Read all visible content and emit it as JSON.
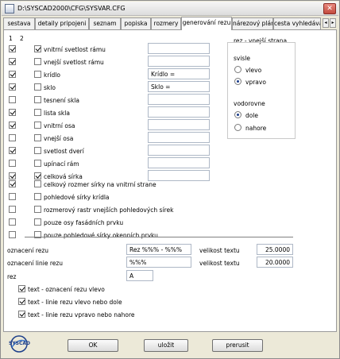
{
  "window": {
    "title": "D:\\SYSCAD2000\\CFG\\SYSVAR.CFG"
  },
  "tabs": [
    "sestava",
    "detaily pripojeni",
    "seznam",
    "popiska",
    "rozmery",
    "generování rezu",
    "nárezový plán",
    "cesta vyhledávání"
  ],
  "active_tab": "generování rezu",
  "columns": [
    "1",
    "2"
  ],
  "rows": [
    {
      "label": "vnitrní svetlost rámu",
      "c1": true,
      "c2": true,
      "value": ""
    },
    {
      "label": "vnejší svetlost rámu",
      "c1": true,
      "c2": false,
      "value": ""
    },
    {
      "label": "krídlo",
      "c1": true,
      "c2": false,
      "value": "Krídlo ="
    },
    {
      "label": "sklo",
      "c1": true,
      "c2": false,
      "value": "Sklo  ="
    },
    {
      "label": "tesnení skla",
      "c1": false,
      "c2": false,
      "value": ""
    },
    {
      "label": "lista skla",
      "c1": true,
      "c2": false,
      "value": ""
    },
    {
      "label": "vnitrní osa",
      "c1": true,
      "c2": false,
      "value": ""
    },
    {
      "label": "vnejší osa",
      "c1": false,
      "c2": false,
      "value": ""
    },
    {
      "label": "svetlost dverí",
      "c1": true,
      "c2": false,
      "value": ""
    },
    {
      "label": "upínací rám",
      "c1": false,
      "c2": false,
      "value": ""
    },
    {
      "label": "celková sírka",
      "c1": true,
      "c2": true,
      "value": ""
    }
  ],
  "extra_rows": [
    {
      "label": "celkový rozmer sírky na vnitrní strane",
      "c1": true,
      "c2": false
    },
    {
      "label": "pohledové sírky krídla",
      "c1": false,
      "c2": false
    },
    {
      "label": "rozmerový rastr vnejších pohledových sírek",
      "c1": false,
      "c2": false
    },
    {
      "label": "pouze osy fasádních prvku",
      "c1": false,
      "c2": false
    },
    {
      "label": "pouze pohledové sírky okenních prvku",
      "c1": false,
      "c2": false
    }
  ],
  "side_group": {
    "title": "rez - vnejší strana",
    "vertical_label": "svisle",
    "vertical_options": [
      {
        "label": "vlevo",
        "checked": false
      },
      {
        "label": "vpravo",
        "checked": true
      }
    ],
    "horizontal_label": "vodorovne",
    "horizontal_options": [
      {
        "label": "dole",
        "checked": true
      },
      {
        "label": "nahore",
        "checked": false
      }
    ]
  },
  "section_fields": {
    "section_label": "oznacení rezu",
    "section_value": "Rez %%% - %%%",
    "line_label": "oznacení linie rezu",
    "line_value": "%%%",
    "rez_label": "rez",
    "rez_value": "A",
    "text_size_label": "velikost textu",
    "text_size_1": "25.0000",
    "text_size_2": "20.0000"
  },
  "bottom_checks": [
    {
      "label": "text - oznacení rezu vlevo",
      "checked": true
    },
    {
      "label": "text - linie rezu vlevo nebo dole",
      "checked": true
    },
    {
      "label": "text - linie rezu vpravo nebo nahore",
      "checked": true
    }
  ],
  "buttons": {
    "ok": "OK",
    "save": "uložit",
    "cancel": "prerusit"
  },
  "logo_text": "SYSCAD",
  "colors": {
    "dialog_bg": "#ece9d8",
    "panel_bg": "#ffffff",
    "radio_dot": "#1a3c8a"
  }
}
